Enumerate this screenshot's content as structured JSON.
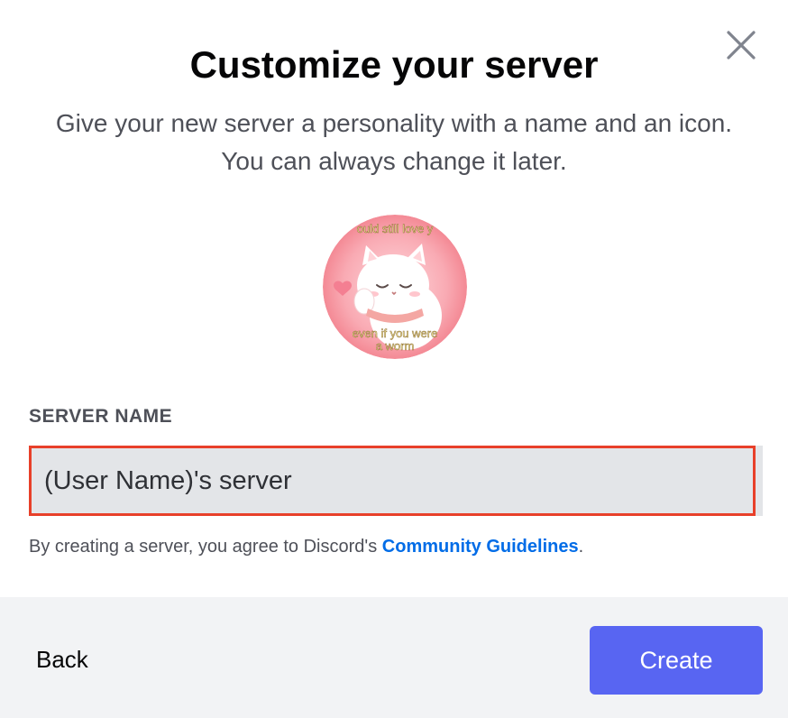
{
  "modal": {
    "title": "Customize your server",
    "subtitle": "Give your new server a personality with a name and an icon. You can always change it later.",
    "close_icon": "close-icon"
  },
  "server_icon": {
    "caption_top": "ould still love y",
    "caption_bottom_1": "even if you were",
    "caption_bottom_2": "a worm"
  },
  "form": {
    "server_name_label": "SERVER NAME",
    "server_name_value": "(User Name)'s server"
  },
  "legal": {
    "prefix": "By creating a server, you agree to Discord's ",
    "link_text": "Community Guidelines",
    "suffix": "."
  },
  "footer": {
    "back_label": "Back",
    "create_label": "Create"
  },
  "colors": {
    "accent": "#5865f2",
    "link": "#006ce7",
    "input_highlight": "#e8402a"
  }
}
